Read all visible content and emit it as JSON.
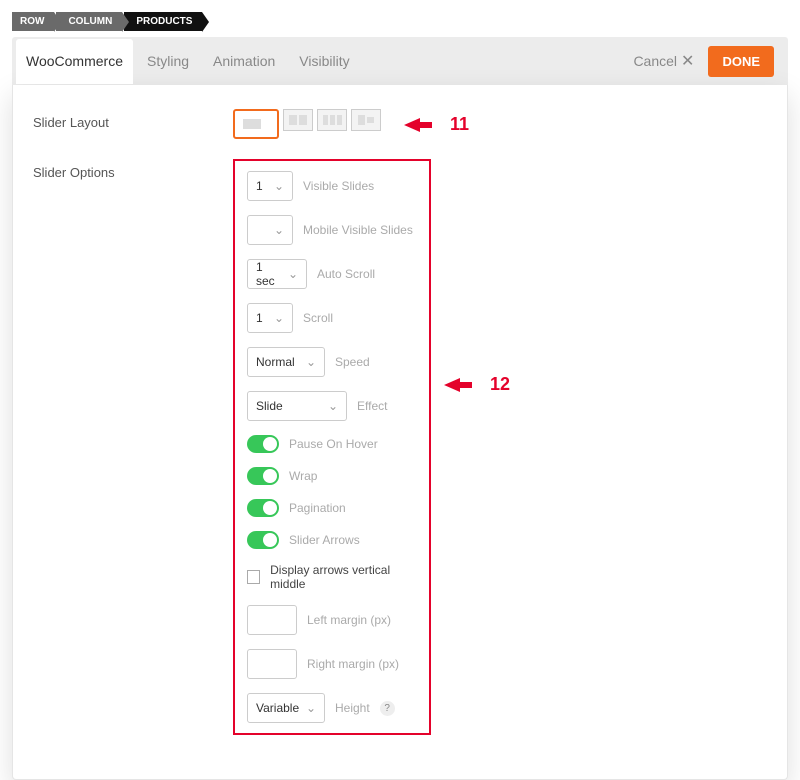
{
  "breadcrumb": [
    "ROW",
    "COLUMN",
    "PRODUCTS"
  ],
  "tabs": {
    "woocommerce": "WooCommerce",
    "styling": "Styling",
    "animation": "Animation",
    "visibility": "Visibility"
  },
  "header": {
    "cancel": "Cancel",
    "done": "DONE"
  },
  "labels": {
    "slider_layout": "Slider Layout",
    "slider_options": "Slider Options"
  },
  "opts": {
    "visible_slides": {
      "value": "1",
      "label": "Visible Slides"
    },
    "mobile_visible": {
      "value": "",
      "label": "Mobile Visible Slides"
    },
    "auto_scroll": {
      "value": "1 sec",
      "label": "Auto Scroll"
    },
    "scroll": {
      "value": "1",
      "label": "Scroll"
    },
    "speed": {
      "value": "Normal",
      "label": "Speed"
    },
    "effect": {
      "value": "Slide",
      "label": "Effect"
    },
    "pause_hover": "Pause On Hover",
    "wrap": "Wrap",
    "pagination": "Pagination",
    "slider_arrows": "Slider Arrows",
    "display_arrows": "Display arrows vertical middle",
    "left_margin": "Left margin (px)",
    "right_margin": "Right margin (px)",
    "height": {
      "value": "Variable",
      "label": "Height"
    }
  },
  "anno": {
    "a11": "11",
    "a12": "12"
  }
}
